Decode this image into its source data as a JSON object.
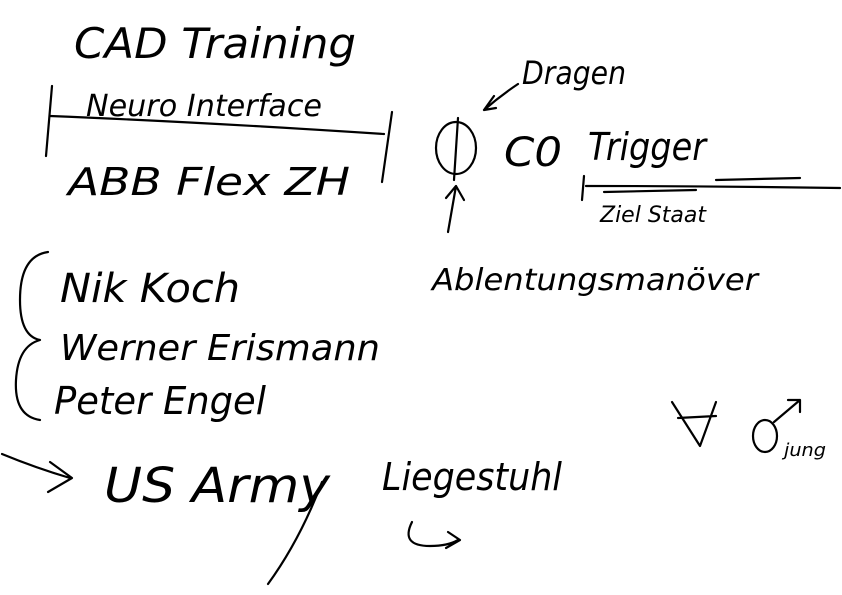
{
  "notes": {
    "title": "CAD Training",
    "subtitle": "Neuro Interface",
    "product": "ABB Flex ZH",
    "dragon": "Dragen",
    "circuit": "C0",
    "trigger": "Trigger",
    "target_state": "Ziel Staat",
    "diversion": "Ablentungsmanöver",
    "people": [
      "Nik Koch",
      "Werner Erismann",
      "Peter Engel"
    ],
    "us_army": "US Army",
    "deckchair": "Liegestuhl",
    "jung": "jung"
  },
  "colors": {
    "ink": "#000000",
    "paper": "#ffffff"
  }
}
